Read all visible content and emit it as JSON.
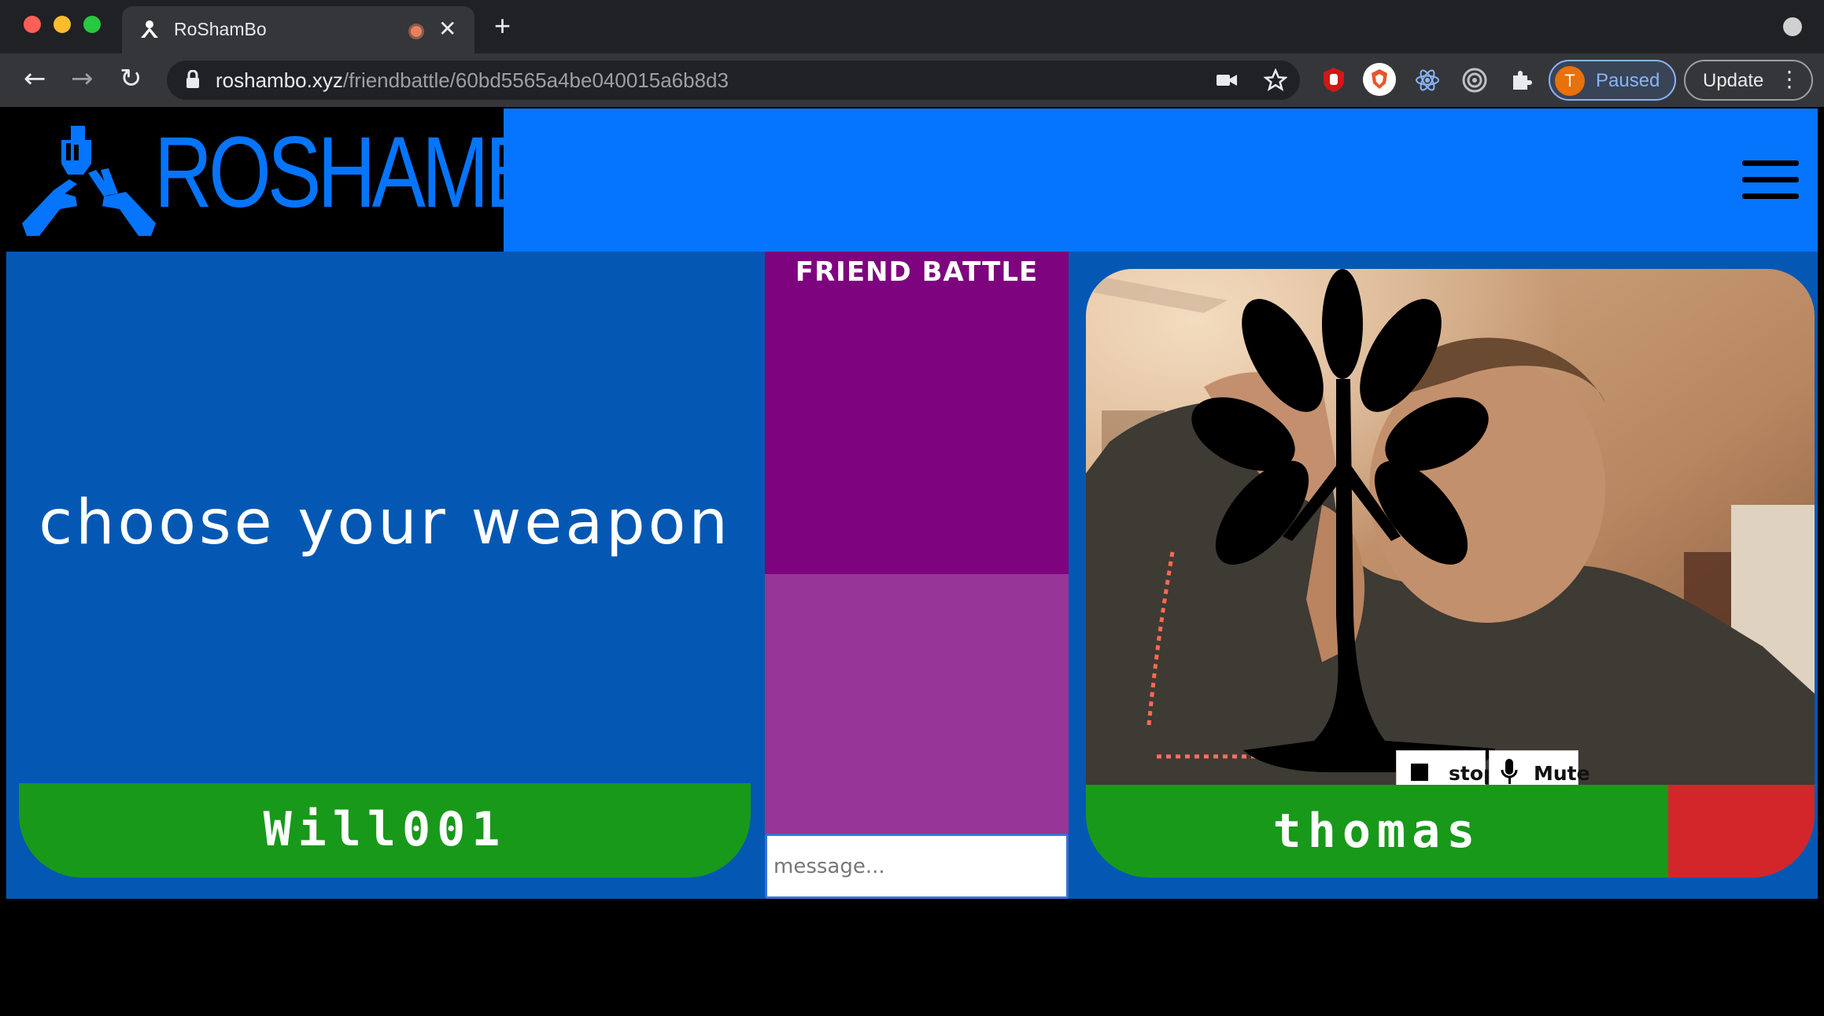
{
  "browser": {
    "tab_title": "RoShamBo",
    "url_host": "roshambo.xyz",
    "url_path": "/friendbattle/60bd5565a4be040015a6b8d3",
    "profile_initial": "T",
    "profile_label": "Paused",
    "update_label": "Update"
  },
  "header": {
    "logo_text": "ROSHAMBO",
    "brand_color": "#0575fe"
  },
  "player": {
    "prompt": "choose your weapon",
    "name": "Will001"
  },
  "chat": {
    "title": "FRIEND BATTLE",
    "input_placeholder": "message..."
  },
  "opponent": {
    "name": "thomas",
    "stop_label": "stop",
    "mute_label": "Mute"
  }
}
